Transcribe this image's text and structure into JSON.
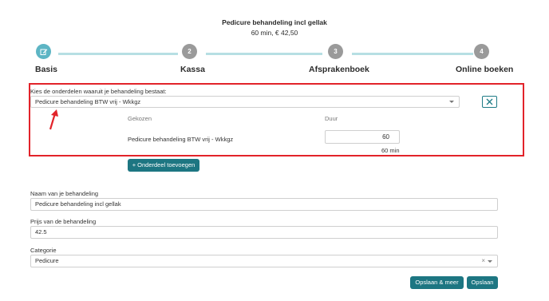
{
  "header": {
    "title": "Pedicure behandeling incl gellak",
    "subtitle": "60 min,  € 42,50"
  },
  "steps": [
    {
      "number": "",
      "label": "Basis",
      "active": true,
      "icon": "edit-icon"
    },
    {
      "number": "2",
      "label": "Kassa",
      "active": false
    },
    {
      "number": "3",
      "label": "Afsprakenboek",
      "active": false
    },
    {
      "number": "4",
      "label": "Online boeken",
      "active": false
    }
  ],
  "components": {
    "label": "Kies de onderdelen waaruit je behandeling bestaat:",
    "selected_value": "Pedicure behandeling BTW vrij - Wkkgz",
    "table": {
      "col_chosen": "Gekozen",
      "col_duration": "Duur",
      "rows": [
        {
          "name": "Pedicure behandeling BTW vrij - Wkkgz",
          "duration_value": "60",
          "duration_text": "60 min"
        }
      ]
    },
    "add_button": "+ Onderdeel toevoegen"
  },
  "form": {
    "name_label": "Naam van je behandeling",
    "name_value": "Pedicure behandeling incl gellak",
    "price_label": "Prijs van de behandeling",
    "price_value": "42.5",
    "category_label": "Categorie",
    "category_value": "Pedicure",
    "category_clear": "×"
  },
  "actions": {
    "save_more": "Opslaan & meer",
    "save": "Opslaan"
  },
  "colors": {
    "accent": "#1d7682",
    "step_active": "#5db5c4",
    "step_inactive": "#9a9a9a",
    "highlight": "#e2232a"
  }
}
